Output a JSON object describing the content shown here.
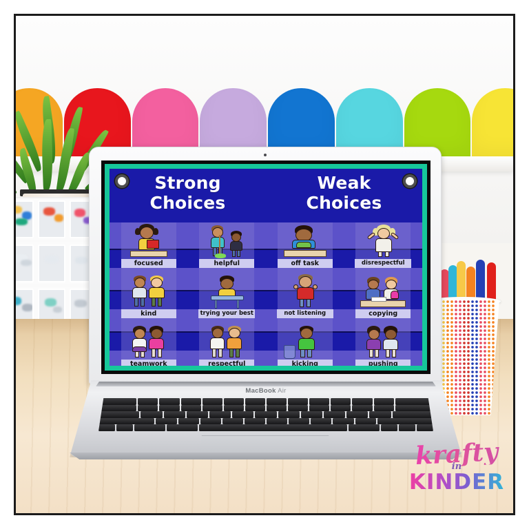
{
  "photo": {
    "scene_description": "Classroom desk photo with a MacBook Air displaying a sorting activity slide",
    "wall_banner_colors": [
      "#f5a623",
      "#e8161d",
      "#f3609f",
      "#c6aade",
      "#1275d1",
      "#57d6e0",
      "#a6d90f",
      "#f7e435"
    ],
    "desk_color": "#f2dfbf",
    "frame_color": "#1b1b1b"
  },
  "laptop": {
    "model_label_bold": "MacBook",
    "model_label_light": " Air",
    "body_color": "#dcdde0",
    "key_color": "#1a1a1c"
  },
  "slide": {
    "background_color": "#1a1aa8",
    "band_color": "#5c52c9",
    "border_color": "#16c79a",
    "caption_color": "#cfcdf0",
    "grommets": [
      "grommet-left",
      "grommet-right"
    ],
    "columns": [
      {
        "title_line1": "Strong",
        "title_line2": "Choices"
      },
      {
        "title_line1": "Weak",
        "title_line2": "Choices"
      }
    ],
    "cards": [
      {
        "label": "focused",
        "side": "strong",
        "row": 1,
        "col": 1,
        "art": "girl-reading-at-desk"
      },
      {
        "label": "helpful",
        "side": "strong",
        "row": 1,
        "col": 2,
        "art": "two-kids-sweeping"
      },
      {
        "label": "off task",
        "side": "weak",
        "row": 1,
        "col": 3,
        "art": "boy-head-down-on-desk"
      },
      {
        "label": "disrespectful",
        "side": "weak",
        "row": 1,
        "col": 4,
        "art": "girl-arms-raised"
      },
      {
        "label": "kind",
        "side": "strong",
        "row": 2,
        "col": 1,
        "art": "two-kids-hugging"
      },
      {
        "label": "trying your best",
        "side": "strong",
        "row": 2,
        "col": 2,
        "art": "boy-working-at-desk"
      },
      {
        "label": "not listening",
        "side": "weak",
        "row": 2,
        "col": 3,
        "art": "boy-covering-ears"
      },
      {
        "label": "copying",
        "side": "weak",
        "row": 2,
        "col": 4,
        "art": "two-kids-at-desk-copying"
      },
      {
        "label": "teamwork",
        "side": "strong",
        "row": 3,
        "col": 1,
        "art": "two-girls-arm-in-arm"
      },
      {
        "label": "respectful",
        "side": "strong",
        "row": 3,
        "col": 2,
        "art": "two-boys-side-by-side"
      },
      {
        "label": "kicking",
        "side": "weak",
        "row": 3,
        "col": 3,
        "art": "boy-kicking-trash-can"
      },
      {
        "label": "pushing",
        "side": "weak",
        "row": 3,
        "col": 4,
        "art": "girl-pushing-girl"
      }
    ]
  },
  "watermark": {
    "line1": "krafty",
    "line2": "in",
    "line3": "KINDER",
    "color1": "#ea3fae",
    "color2": "#7f5ab8",
    "color3": "#2fb6d8"
  },
  "props": {
    "plant": "green-fern-in-white-pot",
    "shelf": "storage-bins-with-supplies",
    "cup": "mesh-cup-with-markers",
    "marker_colors": [
      "#7e3fb5",
      "#e84a5f",
      "#2fb6d8",
      "#f7c948",
      "#f58220",
      "#2440b5",
      "#e0201b"
    ]
  }
}
